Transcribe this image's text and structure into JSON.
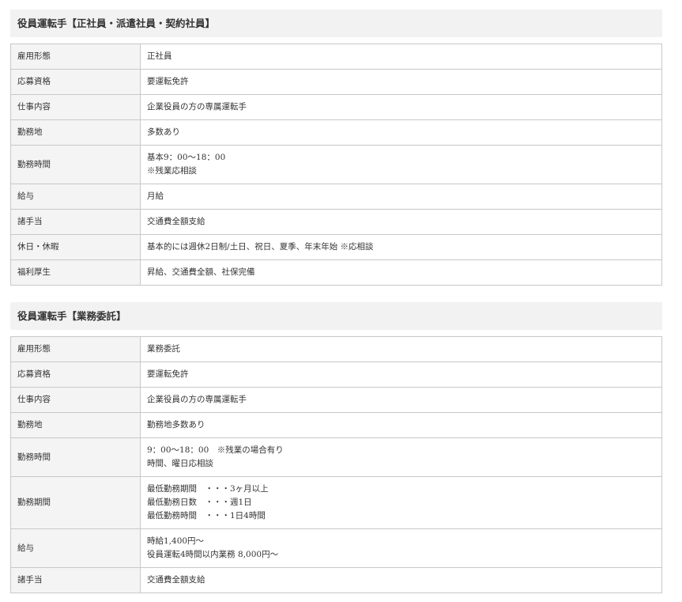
{
  "sections": [
    {
      "title": "役員運転手【正社員・派遣社員・契約社員】",
      "rows": [
        {
          "label": "雇用形態",
          "lines": [
            "正社員"
          ]
        },
        {
          "label": "応募資格",
          "lines": [
            "要運転免許"
          ]
        },
        {
          "label": "仕事内容",
          "lines": [
            "企業役員の方の専属運転手"
          ]
        },
        {
          "label": "勤務地",
          "lines": [
            "多数あり"
          ]
        },
        {
          "label": "勤務時間",
          "lines": [
            "基本9：00〜18：00",
            "※残業応相談"
          ]
        },
        {
          "label": "給与",
          "lines": [
            "月給"
          ]
        },
        {
          "label": "諸手当",
          "lines": [
            "交通費全額支給"
          ]
        },
        {
          "label": "休日・休暇",
          "lines": [
            "基本的には週休2日制/土日、祝日、夏季、年末年始 ※応相談"
          ]
        },
        {
          "label": "福利厚生",
          "lines": [
            "昇給、交通費全額、社保完備"
          ]
        }
      ]
    },
    {
      "title": "役員運転手【業務委託】",
      "rows": [
        {
          "label": "雇用形態",
          "lines": [
            "業務委託"
          ]
        },
        {
          "label": "応募資格",
          "lines": [
            "要運転免許"
          ]
        },
        {
          "label": "仕事内容",
          "lines": [
            "企業役員の方の専属運転手"
          ]
        },
        {
          "label": "勤務地",
          "lines": [
            "勤務地多数あり"
          ]
        },
        {
          "label": "勤務時間",
          "lines": [
            "9：00〜18：00　※残業の場合有り",
            "時間、曜日応相談"
          ]
        },
        {
          "label": "勤務期間",
          "lines": [
            "最低勤務期間　・・・3ヶ月以上",
            "最低勤務日数　・・・週1日",
            "最低勤務時間　・・・1日4時間"
          ]
        },
        {
          "label": "給与",
          "lines": [
            "時給1,400円〜",
            "役員運転4時間以内業務 8,000円〜"
          ]
        },
        {
          "label": "諸手当",
          "lines": [
            "交通費全額支給"
          ]
        }
      ]
    }
  ]
}
